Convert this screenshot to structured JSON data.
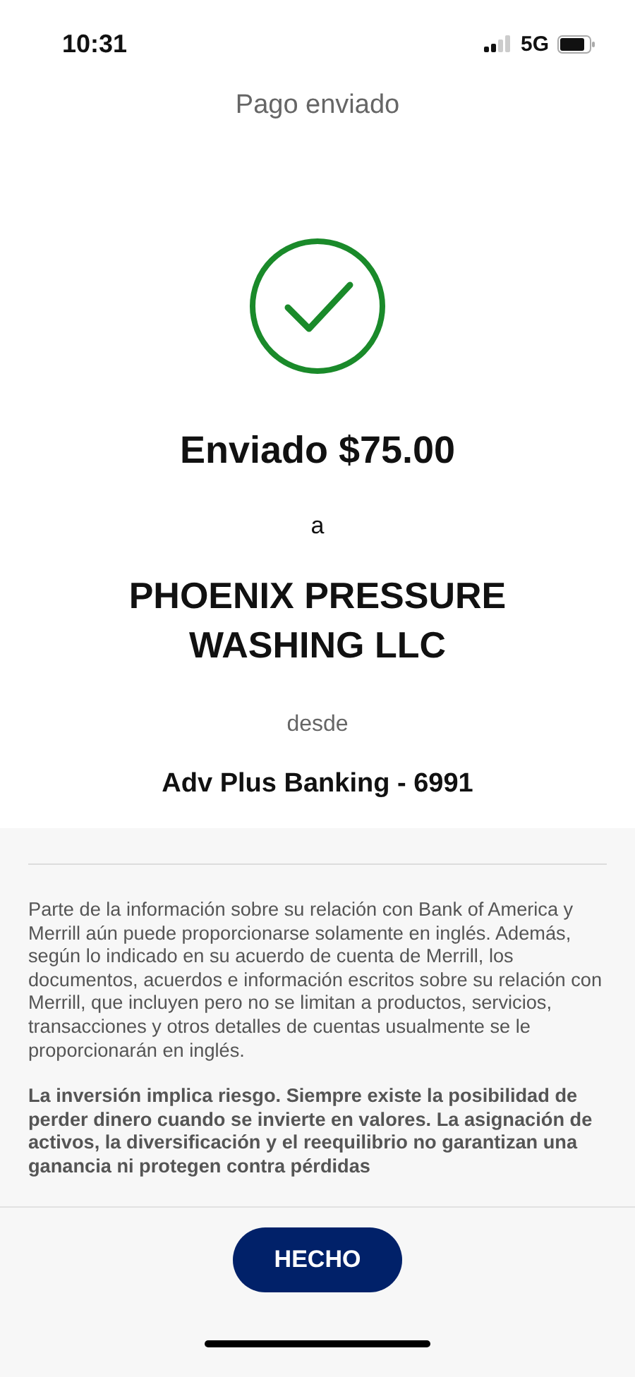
{
  "status_bar": {
    "time": "10:31",
    "network": "5G"
  },
  "header": {
    "title": "Pago enviado"
  },
  "confirmation": {
    "amount_line": "Enviado $75.00",
    "to_label": "a",
    "payee": "PHOENIX PRESSURE WASHING LLC",
    "from_label": "desde",
    "account": "Adv Plus Banking - 6991"
  },
  "disclosures": [
    {
      "kind": "plain",
      "text": "Parte de la información sobre su relación con Bank of America y Merrill aún puede proporcionarse solamente en inglés. Además, según lo indicado en su acuerdo de cuenta de Merrill, los documentos, acuerdos e información escritos sobre su relación con Merrill, que incluyen pero no se limitan a productos, servicios, transacciones y otros detalles de cuentas usualmente se le proporcionarán en inglés."
    },
    {
      "kind": "bold",
      "text": "La inversión implica riesgo. Siempre existe la posibilidad de perder dinero cuando se invierte en valores. La asignación de activos, la diversificación y el reequilibrio no garantizan una ganancia ni protegen contra pérdidas"
    }
  ],
  "footer": {
    "button": "HECHO"
  }
}
